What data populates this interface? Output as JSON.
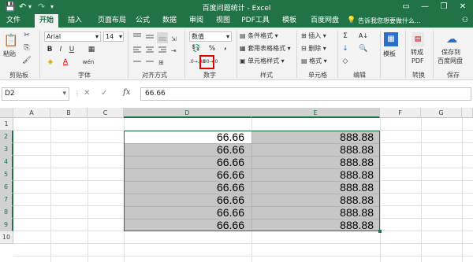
{
  "window": {
    "title": "百度问题统计 - Excel",
    "minimize": "—",
    "restore": "❐",
    "close": "✕"
  },
  "quick_access": {
    "save": "💾",
    "undo": "↶",
    "undo_more": "▾",
    "redo": "↷",
    "customize": "▾"
  },
  "tabs": [
    "文件",
    "开始",
    "插入",
    "页面布局",
    "公式",
    "数据",
    "审阅",
    "视图",
    "PDF工具",
    "模板",
    "百度网盘"
  ],
  "active_tab": "开始",
  "tell_me": "告诉我您想要做什么...",
  "ribbon": {
    "clipboard": {
      "paste": "粘贴",
      "cut": "✂",
      "copy": "⎘",
      "painter": "🖌",
      "label": "剪贴板"
    },
    "font": {
      "name": "Arial",
      "size": "14",
      "grow": "A",
      "shrink": "A",
      "bold": "B",
      "italic": "I",
      "underline": "U",
      "border": "▦",
      "fill": "◈",
      "color": "A",
      "phonetic": "wén",
      "label": "字体"
    },
    "alignment": {
      "label": "对齐方式"
    },
    "number": {
      "format": "数值",
      "currency": "💱",
      "percent": "%",
      "comma": ",",
      "inc_decimal": ".0→.00",
      "dec_decimal": ".00→.0",
      "label": "数字"
    },
    "styles": {
      "conditional": "条件格式",
      "table": "套用表格格式",
      "cell_styles": "单元格样式",
      "label": "样式"
    },
    "cells": {
      "insert": "插入",
      "delete": "删除",
      "format": "格式",
      "label": "单元格"
    },
    "editing": {
      "sum": "Σ",
      "fill": "↓",
      "clear": "◇",
      "sort": "A↓",
      "find": "🔍",
      "label": "编辑"
    },
    "template": {
      "button": "模板"
    },
    "convert": {
      "button_line1": "转成",
      "button_line2": "PDF",
      "label": "转换"
    },
    "save": {
      "button_line1": "保存到",
      "button_line2": "百度网盘",
      "label": "保存"
    }
  },
  "formula_bar": {
    "name_box": "D2",
    "cancel": "✕",
    "enter": "✓",
    "fx": "fx",
    "value": "66.66"
  },
  "columns": [
    "A",
    "B",
    "C",
    "D",
    "E",
    "F",
    "G"
  ],
  "selected_columns": [
    "D",
    "E"
  ],
  "rows": [
    "1",
    "2",
    "3",
    "4",
    "5",
    "6",
    "7",
    "8",
    "9",
    "10"
  ],
  "selected_rows": [
    "2",
    "3",
    "4",
    "5",
    "6",
    "7",
    "8",
    "9"
  ],
  "cells": {
    "D": [
      "66.66",
      "66.66",
      "66.66",
      "66.66",
      "66.66",
      "66.66",
      "66.66",
      "66.66"
    ],
    "E": [
      "888.88",
      "888.88",
      "888.88",
      "888.88",
      "888.88",
      "888.88",
      "888.88",
      "888.88"
    ]
  },
  "colors": {
    "accent": "#217346",
    "selection_fill": "#c6c6c6",
    "highlight_box": "#e00000"
  }
}
